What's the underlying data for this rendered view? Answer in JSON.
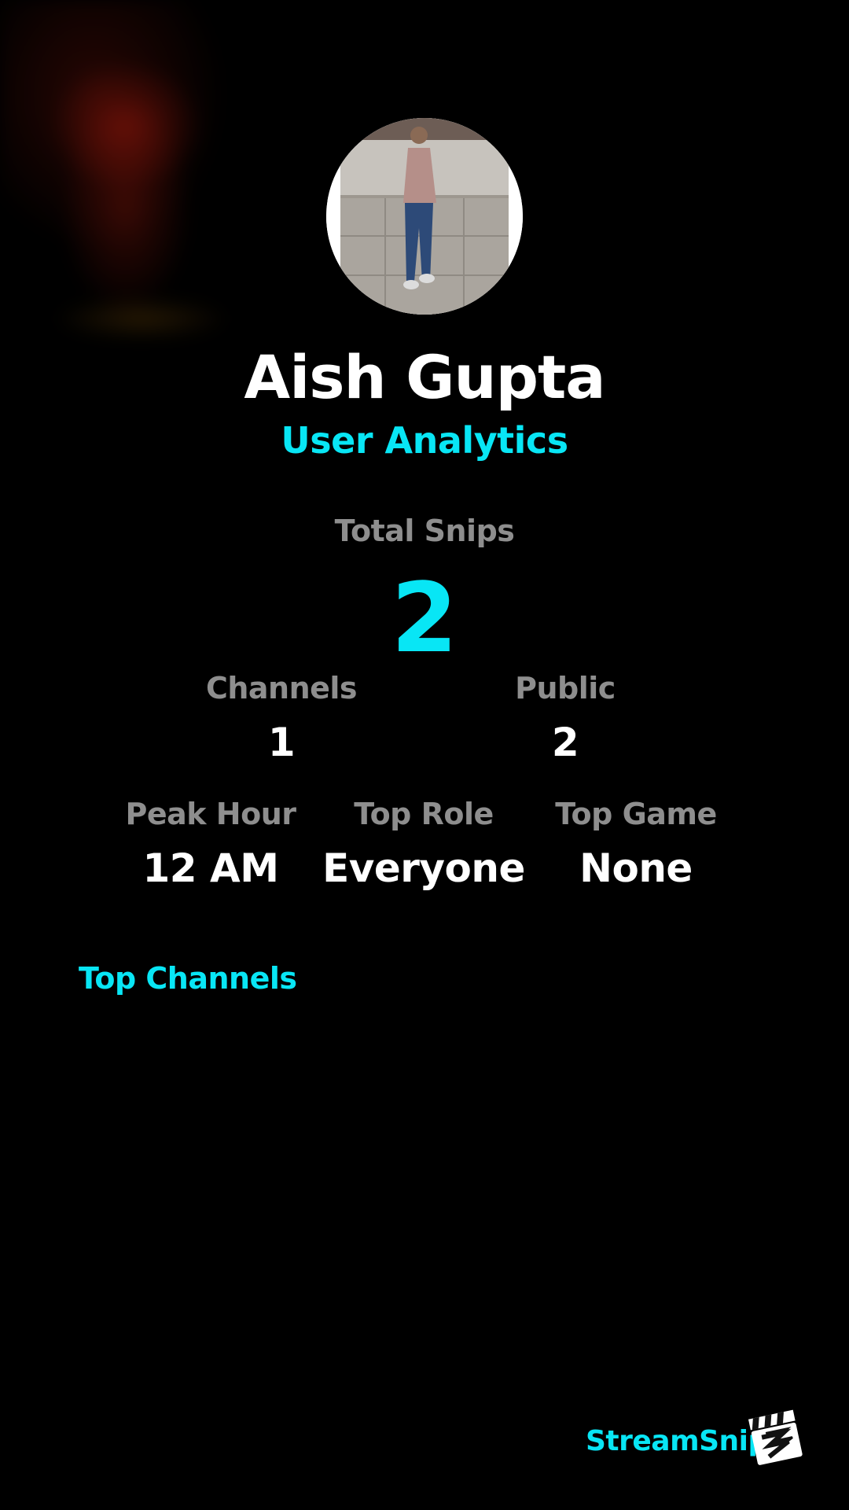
{
  "profile": {
    "name": "Aish Gupta",
    "subtitle": "User Analytics"
  },
  "total": {
    "label": "Total Snips",
    "value": "2"
  },
  "stats_row1": [
    {
      "label": "Channels",
      "value": "1"
    },
    {
      "label": "Public",
      "value": "2"
    }
  ],
  "stats_row2": [
    {
      "label": "Peak Hour",
      "value": "12 AM"
    },
    {
      "label": "Top Role",
      "value": "Everyone"
    },
    {
      "label": "Top Game",
      "value": "None"
    }
  ],
  "top_channels": {
    "title": "Top Channels"
  },
  "brand": {
    "name": "StreamSnip",
    "logo_icon": "clapperboard-icon"
  },
  "colors": {
    "accent": "#08e6f5",
    "label": "#8e8e8e",
    "background": "#000000",
    "text": "#ffffff"
  }
}
